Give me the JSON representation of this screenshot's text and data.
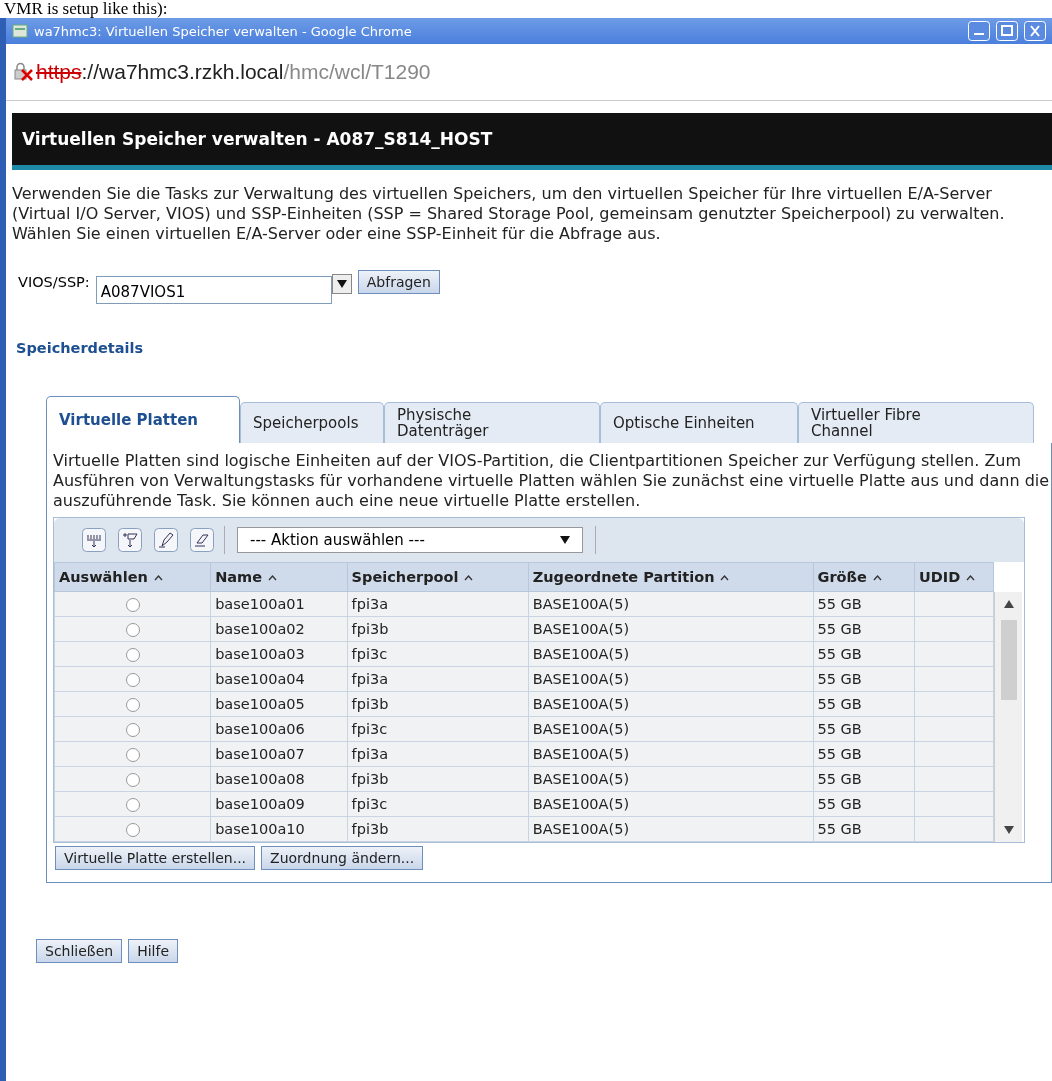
{
  "caption": "VMR is setup like this):",
  "window": {
    "title": "wa7hmc3: Virtuellen Speicher verwalten - Google Chrome"
  },
  "address": {
    "scheme": "https",
    "host": "://wa7hmc3.rzkh.local",
    "path": "/hmc/wcl/T1290"
  },
  "page": {
    "title": "Virtuellen Speicher verwalten - A087_S814_HOST",
    "intro": "Verwenden Sie die Tasks zur Verwaltung des virtuellen Speichers, um den virtuellen Speicher für Ihre virtuellen E/A-Server (Virtual I/O Server, VIOS) und SSP-Einheiten (SSP = Shared Storage Pool, gemeinsam genutzter Speicherpool) zu verwalten. Wählen Sie einen virtuellen E/A-Server oder eine SSP-Einheit für die Abfrage aus.",
    "vios_label": "VIOS/SSP:",
    "vios_value": "A087VIOS1",
    "query_button": "Abfragen",
    "section": "Speicherdetails"
  },
  "tabs": [
    {
      "label": "Virtuelle Platten",
      "selected": true
    },
    {
      "label": "Speicherpools",
      "selected": false
    },
    {
      "label": "Physische Datenträger",
      "selected": false
    },
    {
      "label": "Optische Einheiten",
      "selected": false
    },
    {
      "label": "Virtueller Fibre Channel",
      "selected": false
    }
  ],
  "tab_text": "Virtuelle Platten sind logische Einheiten auf der VIOS-Partition, die Clientpartitionen Speicher zur Verfügung stellen. Zum Ausführen von Verwaltungstasks für vorhandene virtuelle Platten wählen Sie zunächst eine virtuelle Platte aus und dann die auszuführende Task. Sie können auch eine neue virtuelle Platte erstellen.",
  "action_select": "--- Aktion auswählen ---",
  "table": {
    "columns": [
      "Auswählen",
      "Name",
      "Speicherpool",
      "Zugeordnete Partition",
      "Größe",
      "UDID"
    ],
    "rows": [
      {
        "selected": false,
        "name": "base100a01",
        "pool": "fpi3a",
        "partition": "BASE100A(5)",
        "size": "55 GB"
      },
      {
        "selected": false,
        "name": "base100a02",
        "pool": "fpi3b",
        "partition": "BASE100A(5)",
        "size": "55 GB"
      },
      {
        "selected": false,
        "name": "base100a03",
        "pool": "fpi3c",
        "partition": "BASE100A(5)",
        "size": "55 GB"
      },
      {
        "selected": false,
        "name": "base100a04",
        "pool": "fpi3a",
        "partition": "BASE100A(5)",
        "size": "55 GB"
      },
      {
        "selected": false,
        "name": "base100a05",
        "pool": "fpi3b",
        "partition": "BASE100A(5)",
        "size": "55 GB"
      },
      {
        "selected": false,
        "name": "base100a06",
        "pool": "fpi3c",
        "partition": "BASE100A(5)",
        "size": "55 GB"
      },
      {
        "selected": false,
        "name": "base100a07",
        "pool": "fpi3a",
        "partition": "BASE100A(5)",
        "size": "55 GB"
      },
      {
        "selected": false,
        "name": "base100a08",
        "pool": "fpi3b",
        "partition": "BASE100A(5)",
        "size": "55 GB"
      },
      {
        "selected": false,
        "name": "base100a09",
        "pool": "fpi3c",
        "partition": "BASE100A(5)",
        "size": "55 GB"
      },
      {
        "selected": false,
        "name": "base100a10",
        "pool": "fpi3b",
        "partition": "BASE100A(5)",
        "size": "55 GB"
      }
    ]
  },
  "table_buttons": [
    "Virtuelle Platte erstellen...",
    "Zuordnung ändern..."
  ],
  "footer_buttons": [
    "Schließen",
    "Hilfe"
  ]
}
